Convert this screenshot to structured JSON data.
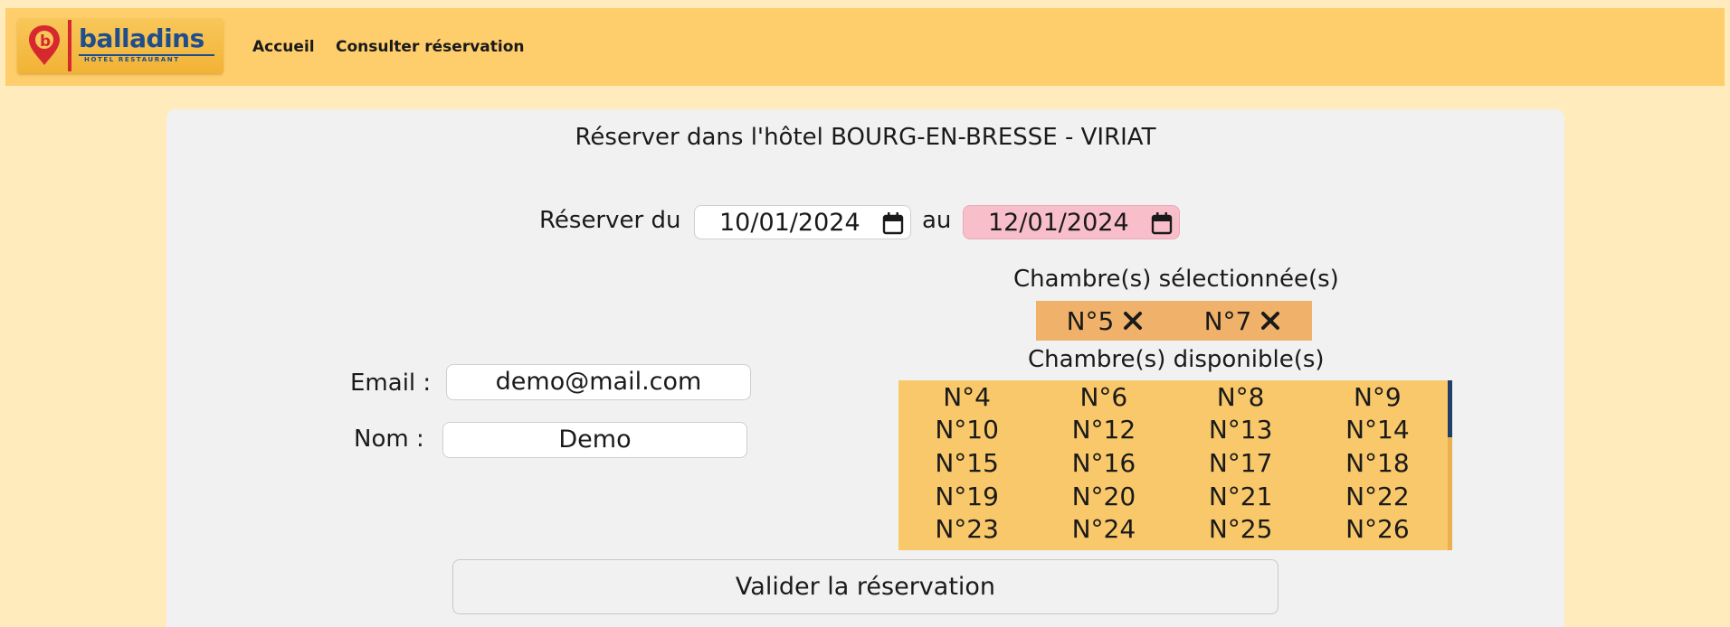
{
  "header": {
    "logo_word": "balladins",
    "logo_sub": "HÔTEL RESTAURANT",
    "nav": {
      "home": "Accueil",
      "consult": "Consulter réservation"
    }
  },
  "booking": {
    "title": "Réserver dans l'hôtel BOURG-EN-BRESSE - VIRIAT",
    "from_label": "Réserver du",
    "from_date": "10/01/2024",
    "to_label": "au",
    "to_date": "12/01/2024",
    "email_label": "Email :",
    "email_value": "demo@mail.com",
    "name_label": "Nom :",
    "name_value": "Demo",
    "selected_heading": "Chambre(s) sélectionnée(s)",
    "selected_rooms": [
      "N°5",
      "N°7"
    ],
    "available_heading": "Chambre(s) disponible(s)",
    "available_rooms": [
      "N°4",
      "N°6",
      "N°8",
      "N°9",
      "N°10",
      "N°12",
      "N°13",
      "N°14",
      "N°15",
      "N°16",
      "N°17",
      "N°18",
      "N°19",
      "N°20",
      "N°21",
      "N°22",
      "N°23",
      "N°24",
      "N°25",
      "N°26"
    ],
    "submit_label": "Valider la réservation"
  },
  "colors": {
    "page_bg": "#ffebbb",
    "navbar": "#fecd6c",
    "card": "#f1f1f1",
    "selected_bg": "#f0b26a",
    "available_bg": "#f9c86a",
    "invalid_date": "#f8bfcb",
    "brand_blue": "#1f4e8c",
    "brand_red": "#d6282e"
  },
  "icons": {
    "calendar": "calendar-icon",
    "remove": "close-icon",
    "logo_pin": "location-pin-icon"
  }
}
